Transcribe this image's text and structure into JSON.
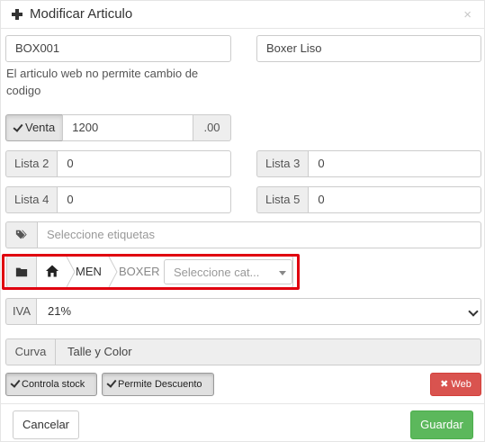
{
  "header": {
    "title": "Modificar Articulo",
    "close": "×"
  },
  "article": {
    "code": "BOX001",
    "name": "Boxer Liso",
    "hint": "El articulo web no permite cambio de codigo"
  },
  "prices": {
    "venta_label": "Venta",
    "venta_value": "1200",
    "venta_suffix": ".00",
    "lista2_label": "Lista 2",
    "lista2_value": "0",
    "lista3_label": "Lista 3",
    "lista3_value": "0",
    "lista4_label": "Lista 4",
    "lista4_value": "0",
    "lista5_label": "Lista 5",
    "lista5_value": "0"
  },
  "tags": {
    "placeholder": "Seleccione etiquetas",
    "icon": "tags-icon"
  },
  "category": {
    "crumbs": [
      "MEN",
      "BOXER"
    ],
    "placeholder": "Seleccione cat...",
    "icons": [
      "folder-icon",
      "home-icon"
    ]
  },
  "iva": {
    "label": "IVA",
    "value": "21%"
  },
  "curva": {
    "label": "Curva",
    "value": "Talle y Color"
  },
  "toggles": {
    "stock": "Controla stock",
    "discount": "Permite Descuento",
    "web": "Web"
  },
  "footer": {
    "cancel": "Cancelar",
    "save": "Guardar"
  },
  "colors": {
    "danger": "#d9534f",
    "success": "#5cb85c",
    "highlight": "#e0000f"
  }
}
